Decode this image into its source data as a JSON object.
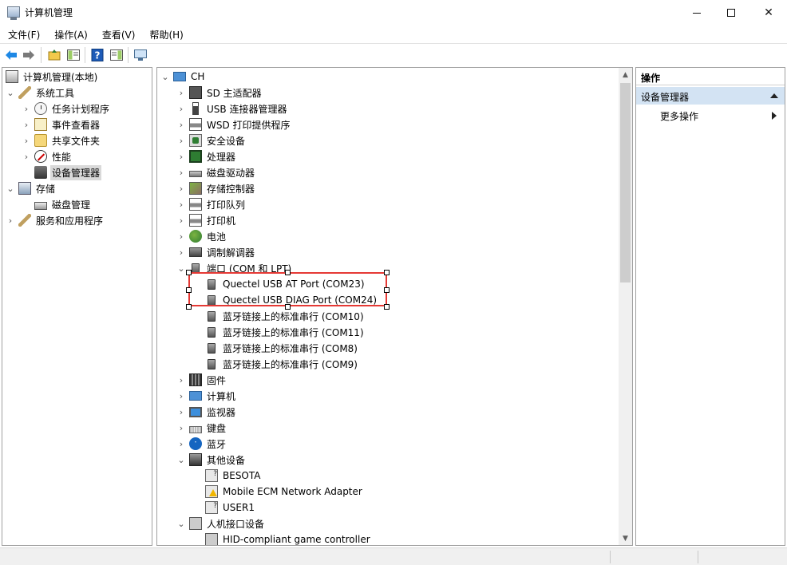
{
  "window": {
    "title": "计算机管理",
    "minimize_glyph": "",
    "close_glyph": "✕"
  },
  "menu": [
    "文件(F)",
    "操作(A)",
    "查看(V)",
    "帮助(H)"
  ],
  "toolbar": {
    "icons": [
      "back-arrow-icon",
      "forward-arrow-icon",
      "up-folder-icon",
      "show-tree-icon",
      "help-icon",
      "action-pane-icon",
      "monitor-icon"
    ],
    "back_glyph": "⬅",
    "forward_glyph": "➡",
    "help_glyph": "?"
  },
  "left_tree": {
    "items": [
      {
        "label": "计算机管理(本地)",
        "level": 0,
        "expander": "",
        "icon": "computer-management-icon"
      },
      {
        "label": "系统工具",
        "level": 1,
        "expander": "v",
        "icon": "tools-icon"
      },
      {
        "label": "任务计划程序",
        "level": 2,
        "expander": ">",
        "icon": "clock-icon"
      },
      {
        "label": "事件查看器",
        "level": 2,
        "expander": ">",
        "icon": "event-viewer-icon"
      },
      {
        "label": "共享文件夹",
        "level": 2,
        "expander": ">",
        "icon": "shared-folder-icon"
      },
      {
        "label": "性能",
        "level": 2,
        "expander": ">",
        "icon": "performance-icon"
      },
      {
        "label": "设备管理器",
        "level": 2,
        "expander": "",
        "icon": "device-manager-icon",
        "selected": true
      },
      {
        "label": "存储",
        "level": 1,
        "expander": "v",
        "icon": "storage-icon"
      },
      {
        "label": "磁盘管理",
        "level": 2,
        "expander": "",
        "icon": "disk-icon"
      },
      {
        "label": "服务和应用程序",
        "level": 1,
        "expander": ">",
        "icon": "services-icon"
      }
    ]
  },
  "device_tree": {
    "root": "CH",
    "items": [
      {
        "label": "SD 主适配器",
        "level": 1,
        "expander": ">",
        "icon": "sd-adapter-icon"
      },
      {
        "label": "USB 连接器管理器",
        "level": 1,
        "expander": ">",
        "icon": "usb-icon"
      },
      {
        "label": "WSD 打印提供程序",
        "level": 1,
        "expander": ">",
        "icon": "printer-icon"
      },
      {
        "label": "安全设备",
        "level": 1,
        "expander": ">",
        "icon": "security-device-icon"
      },
      {
        "label": "处理器",
        "level": 1,
        "expander": ">",
        "icon": "processor-icon"
      },
      {
        "label": "磁盘驱动器",
        "level": 1,
        "expander": ">",
        "icon": "disk-drive-icon"
      },
      {
        "label": "存储控制器",
        "level": 1,
        "expander": ">",
        "icon": "storage-controller-icon"
      },
      {
        "label": "打印队列",
        "level": 1,
        "expander": ">",
        "icon": "printer-icon"
      },
      {
        "label": "打印机",
        "level": 1,
        "expander": ">",
        "icon": "printer-icon"
      },
      {
        "label": "电池",
        "level": 1,
        "expander": ">",
        "icon": "battery-icon"
      },
      {
        "label": "调制解调器",
        "level": 1,
        "expander": ">",
        "icon": "modem-icon"
      },
      {
        "label": "端口 (COM 和 LPT)",
        "level": 1,
        "expander": "v",
        "icon": "port-icon"
      },
      {
        "label": "Quectel USB AT Port (COM23)",
        "level": 2,
        "expander": "",
        "icon": "port-icon"
      },
      {
        "label": "Quectel USB DIAG Port (COM24)",
        "level": 2,
        "expander": "",
        "icon": "port-icon"
      },
      {
        "label": "蓝牙链接上的标准串行 (COM10)",
        "level": 2,
        "expander": "",
        "icon": "port-icon"
      },
      {
        "label": "蓝牙链接上的标准串行 (COM11)",
        "level": 2,
        "expander": "",
        "icon": "port-icon"
      },
      {
        "label": "蓝牙链接上的标准串行 (COM8)",
        "level": 2,
        "expander": "",
        "icon": "port-icon"
      },
      {
        "label": "蓝牙链接上的标准串行 (COM9)",
        "level": 2,
        "expander": "",
        "icon": "port-icon"
      },
      {
        "label": "固件",
        "level": 1,
        "expander": ">",
        "icon": "firmware-icon"
      },
      {
        "label": "计算机",
        "level": 1,
        "expander": ">",
        "icon": "computer-icon"
      },
      {
        "label": "监视器",
        "level": 1,
        "expander": ">",
        "icon": "monitor-icon"
      },
      {
        "label": "键盘",
        "level": 1,
        "expander": ">",
        "icon": "keyboard-icon"
      },
      {
        "label": "蓝牙",
        "level": 1,
        "expander": ">",
        "icon": "bluetooth-icon"
      },
      {
        "label": "其他设备",
        "level": 1,
        "expander": "v",
        "icon": "other-devices-icon"
      },
      {
        "label": "BESOTA",
        "level": 2,
        "expander": "",
        "icon": "unknown-device-icon"
      },
      {
        "label": "Mobile ECM Network Adapter",
        "level": 2,
        "expander": "",
        "icon": "warning-device-icon"
      },
      {
        "label": "USER1",
        "level": 2,
        "expander": "",
        "icon": "unknown-device-icon"
      },
      {
        "label": "人机接口设备",
        "level": 1,
        "expander": "v",
        "icon": "hid-icon"
      },
      {
        "label": "HID-compliant game controller",
        "level": 2,
        "expander": "",
        "icon": "hid-icon"
      }
    ]
  },
  "actions": {
    "header": "操作",
    "section": "设备管理器",
    "more": "更多操作"
  },
  "colors": {
    "highlight_box": "#e53935",
    "selected_bg": "#d9d9d9",
    "action_section_bg": "#d3e3f3"
  }
}
